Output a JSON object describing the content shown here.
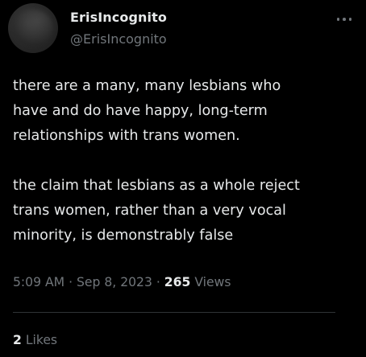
{
  "author": {
    "display_name": "ErisIncognito",
    "handle": "@ErisIncognito"
  },
  "tweet": {
    "paragraphs": [
      {
        "lines": [
          "there are a many, many lesbians who",
          "have and do have happy, long-term",
          "relationships with trans women."
        ]
      },
      {
        "lines": [
          "the claim that lesbians as a whole reject",
          "trans women, rather than a very vocal",
          "minority, is demonstrably false"
        ]
      }
    ]
  },
  "meta": {
    "time": "5:09 AM",
    "separator": "·",
    "date": "Sep 8, 2023",
    "views_count": "265",
    "views_label": "Views"
  },
  "engagement": {
    "likes_count": "2",
    "likes_label": "Likes"
  },
  "icons": {
    "more": "more-horizontal-icon"
  },
  "colors": {
    "background": "#000000",
    "text_primary": "#e7e9ea",
    "text_secondary": "#71767b",
    "divider": "#2f3336"
  }
}
